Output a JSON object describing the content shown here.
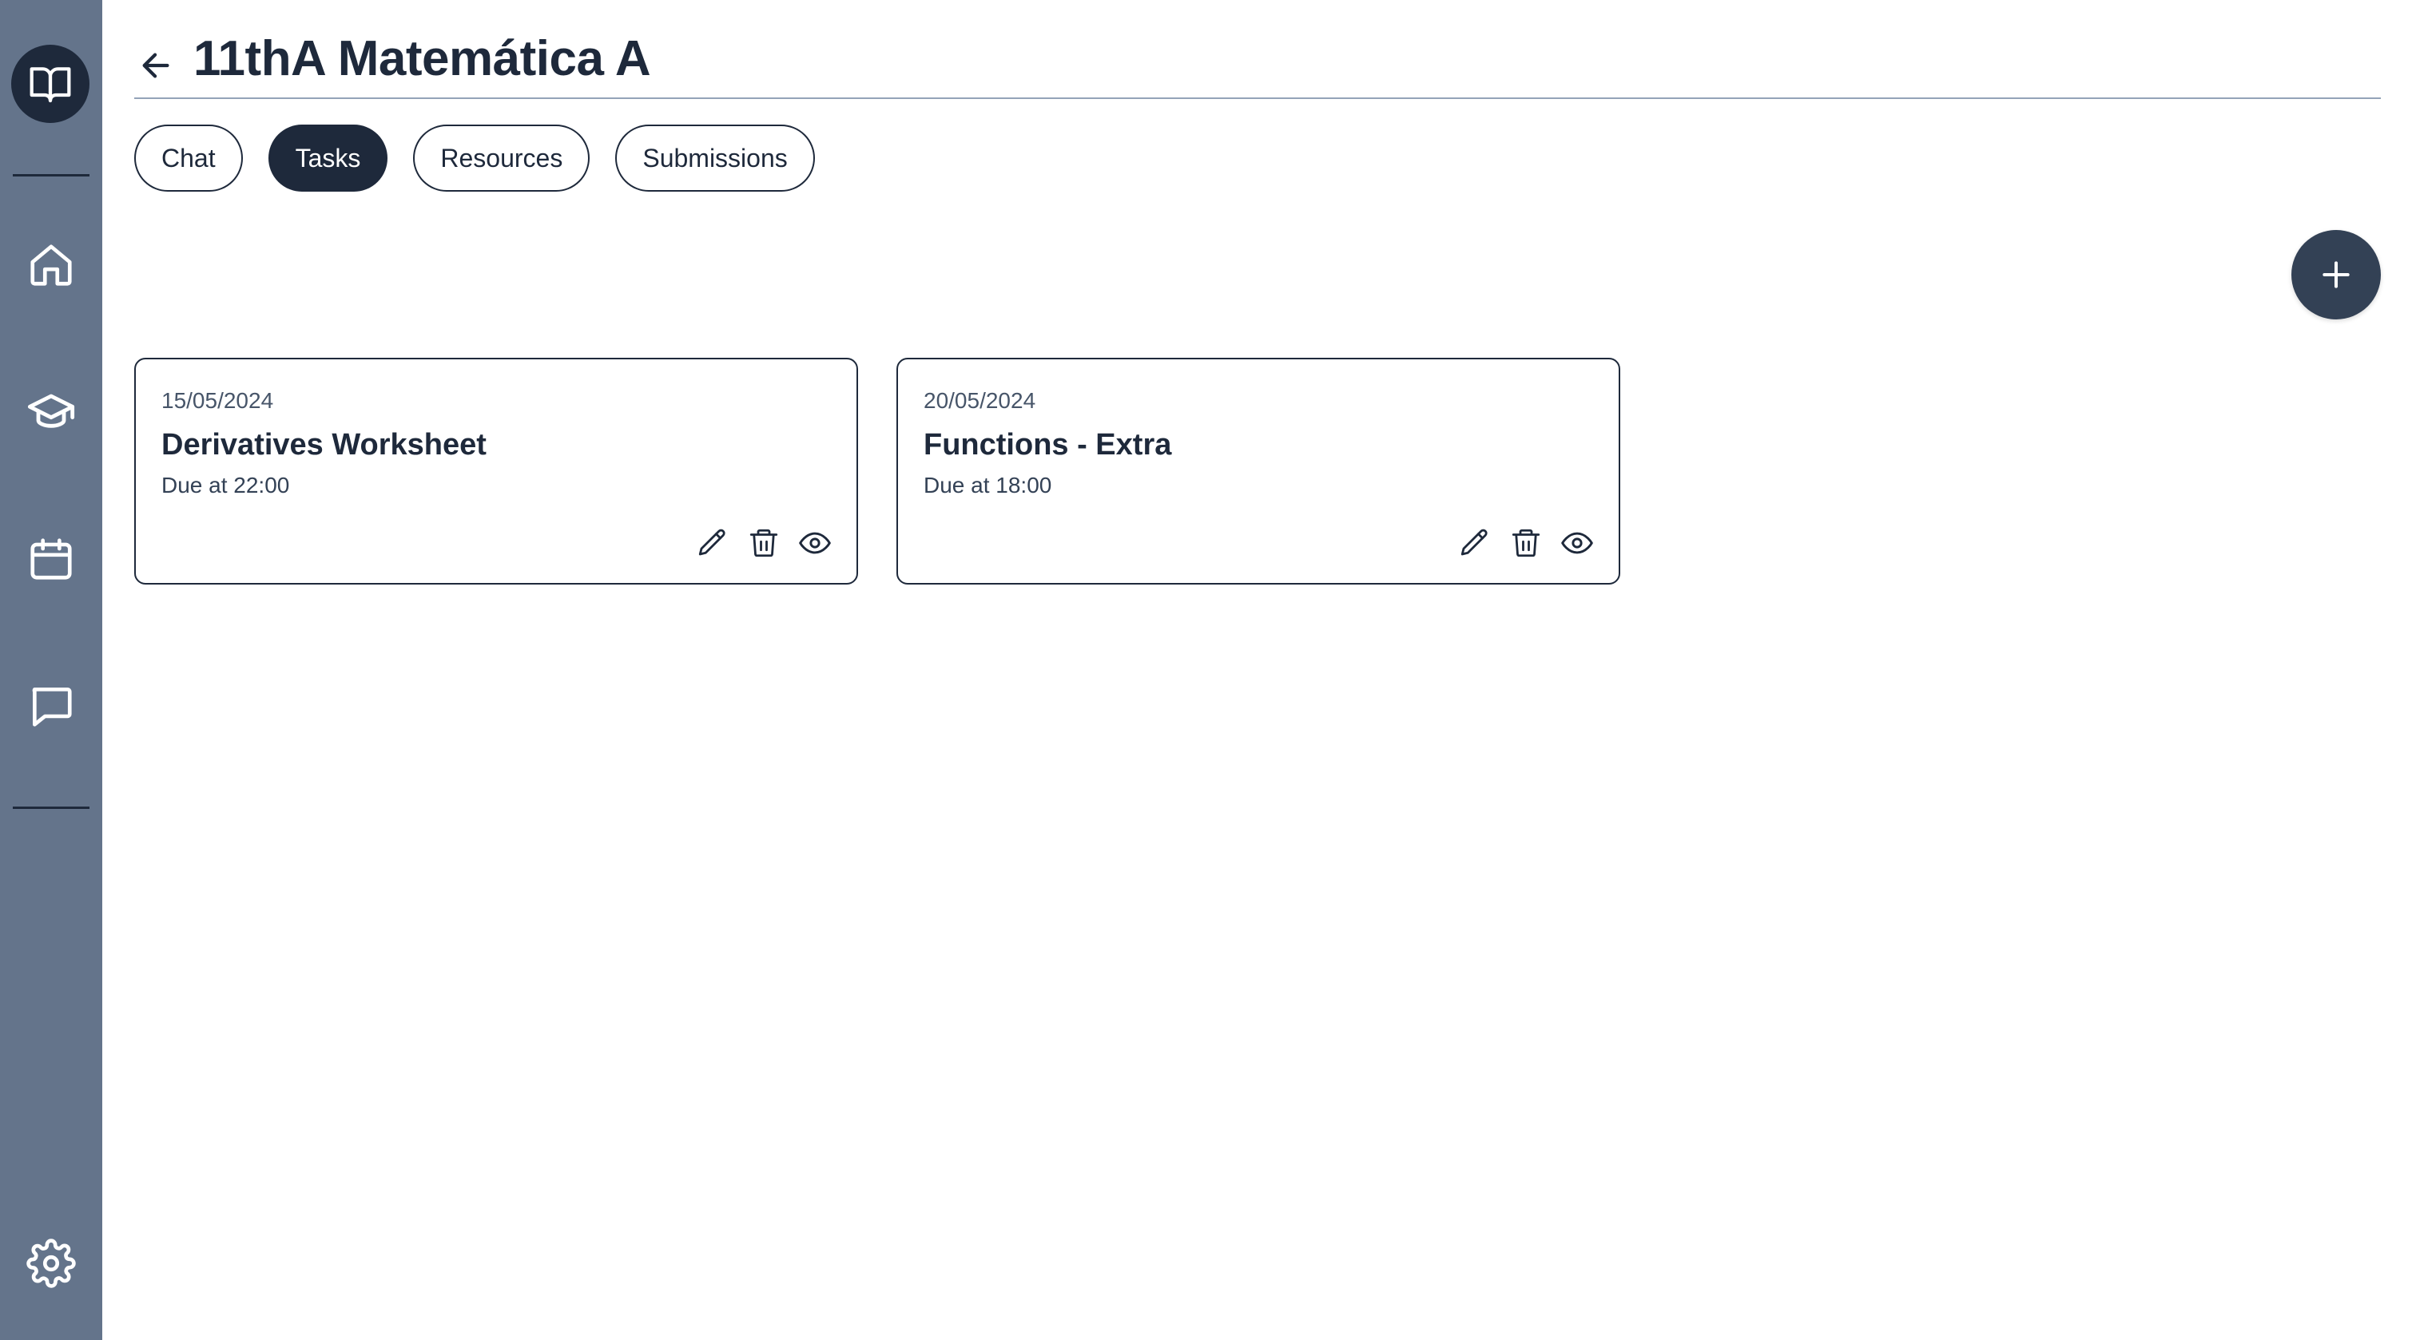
{
  "sidebar": {
    "logo_icon": "book-open-icon",
    "items": [
      {
        "id": "home",
        "icon": "home-icon"
      },
      {
        "id": "courses",
        "icon": "graduation-cap-icon"
      },
      {
        "id": "calendar",
        "icon": "calendar-icon"
      },
      {
        "id": "messages",
        "icon": "chat-bubble-icon"
      }
    ],
    "settings_icon": "gear-icon",
    "colors": {
      "background": "#64748b",
      "accent": "#1e293b"
    }
  },
  "header": {
    "back_icon": "arrow-left-icon",
    "title": "11thA Matemática A"
  },
  "tabs": [
    {
      "label": "Chat",
      "active": false
    },
    {
      "label": "Tasks",
      "active": true
    },
    {
      "label": "Resources",
      "active": false
    },
    {
      "label": "Submissions",
      "active": false
    }
  ],
  "add_button": {
    "icon": "plus-icon"
  },
  "tasks": [
    {
      "date": "15/05/2024",
      "title": "Derivatives Worksheet",
      "due": "Due at 22:00"
    },
    {
      "date": "20/05/2024",
      "title": "Functions - Extra",
      "due": "Due at 18:00"
    }
  ],
  "task_actions": [
    "pencil-icon",
    "trash-icon",
    "eye-icon"
  ]
}
